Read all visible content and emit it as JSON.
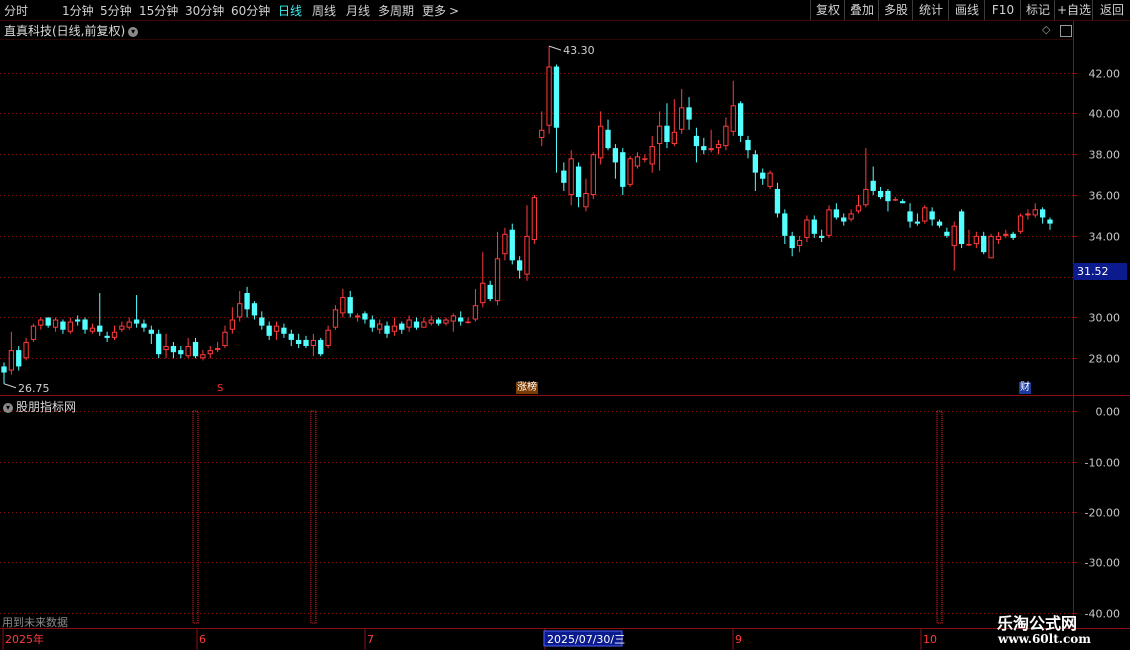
{
  "toolbar": {
    "periods": [
      "分时",
      "1分钟",
      "5分钟",
      "15分钟",
      "30分钟",
      "60分钟",
      "日线",
      "周线",
      "月线",
      "多周期",
      "更多"
    ],
    "active_period": "日线",
    "more_arrow": ">",
    "right_buttons": [
      "复权",
      "叠加",
      "多股",
      "统计",
      "画线",
      "F10",
      "+自选",
      "返回"
    ],
    "mark_button": "标记"
  },
  "header": {
    "stock_title": "直真科技(日线,前复权)",
    "collapse_icon": "chevron-down-icon"
  },
  "indicator": {
    "title": "股朋指标网",
    "warning": "用到未来数据"
  },
  "price_tag": "31.52",
  "markers": [
    {
      "text": "S",
      "color": "#ff3030"
    },
    {
      "text": "涨榜",
      "color": "#ffffff",
      "bg": "#7a3a00"
    },
    {
      "text": "财",
      "color": "#ffffff",
      "bg": "#1a3aa0"
    }
  ],
  "time_axis": {
    "labels": [
      "2025年",
      "6",
      "7",
      "2025/07/30/三",
      "9",
      "10"
    ],
    "highlight": "2025/07/30/三"
  },
  "watermark": {
    "line1": "乐淘公式网",
    "line2": "www.60lt.com"
  },
  "colors": {
    "up": "#ff3b3b",
    "down": "#54ffff",
    "grid": "#8b1010",
    "axis_text": "#c8c8c8",
    "active_period": "#3af0f0"
  },
  "chart_data": {
    "type": "candlestick",
    "price_axis_ticks": [
      42.0,
      40.0,
      38.0,
      36.0,
      34.0,
      32.0,
      30.0,
      28.0
    ],
    "price_ylim": [
      26.2,
      43.6
    ],
    "max_label": "43.30",
    "min_label": "26.75",
    "indicator_axis_ticks": [
      0.0,
      -10.0,
      -20.0,
      -30.0,
      -40.0
    ],
    "indicator_ylim": [
      -43,
      3
    ],
    "signal_bars": [
      {
        "index": 26,
        "from": 0.0,
        "to": -42.0
      },
      {
        "index": 42,
        "from": 0.0,
        "to": -42.0
      },
      {
        "index": 127,
        "from": 0.0,
        "to": -42.0
      }
    ],
    "candles": [
      [
        27.6,
        27.3,
        27.8,
        26.75
      ],
      [
        27.4,
        28.4,
        29.3,
        27.2
      ],
      [
        28.4,
        27.6,
        28.6,
        27.4
      ],
      [
        28.0,
        28.8,
        29.0,
        27.9
      ],
      [
        28.9,
        29.6,
        29.7,
        28.8
      ],
      [
        29.6,
        29.9,
        30.0,
        29.4
      ],
      [
        30.0,
        29.6,
        30.0,
        29.5
      ],
      [
        29.5,
        29.9,
        30.0,
        29.3
      ],
      [
        29.8,
        29.4,
        29.9,
        29.2
      ],
      [
        29.3,
        29.8,
        30.0,
        29.2
      ],
      [
        29.9,
        29.8,
        30.1,
        29.6
      ],
      [
        29.9,
        29.4,
        30.0,
        29.2
      ],
      [
        29.3,
        29.5,
        29.7,
        29.2
      ],
      [
        29.6,
        29.3,
        31.2,
        29.1
      ],
      [
        29.1,
        29.0,
        29.3,
        28.8
      ],
      [
        29.0,
        29.3,
        29.6,
        28.9
      ],
      [
        29.4,
        29.6,
        29.8,
        29.3
      ],
      [
        29.5,
        29.8,
        30.0,
        29.4
      ],
      [
        29.9,
        29.7,
        31.1,
        29.5
      ],
      [
        29.7,
        29.5,
        29.9,
        29.3
      ],
      [
        29.4,
        29.2,
        29.6,
        28.7
      ],
      [
        29.2,
        28.2,
        29.4,
        28.0
      ],
      [
        28.4,
        28.6,
        29.2,
        28.0
      ],
      [
        28.6,
        28.3,
        28.8,
        28.0
      ],
      [
        28.4,
        28.2,
        28.6,
        28.0
      ],
      [
        28.1,
        28.6,
        29.0,
        28.0
      ],
      [
        28.8,
        28.1,
        29.0,
        28.0
      ],
      [
        28.0,
        28.2,
        28.4,
        27.9
      ],
      [
        28.2,
        28.4,
        28.6,
        28.0
      ],
      [
        28.4,
        28.5,
        28.8,
        28.3
      ],
      [
        28.6,
        29.3,
        29.6,
        28.5
      ],
      [
        29.4,
        29.9,
        30.5,
        29.2
      ],
      [
        30.0,
        30.7,
        31.3,
        29.8
      ],
      [
        31.2,
        30.4,
        31.5,
        30.0
      ],
      [
        30.7,
        30.1,
        30.8,
        29.9
      ],
      [
        30.0,
        29.6,
        30.3,
        29.4
      ],
      [
        29.6,
        29.1,
        29.8,
        28.9
      ],
      [
        29.3,
        29.6,
        29.8,
        28.9
      ],
      [
        29.5,
        29.2,
        29.7,
        29.0
      ],
      [
        29.2,
        28.9,
        29.4,
        28.6
      ],
      [
        28.9,
        28.7,
        29.2,
        28.5
      ],
      [
        28.9,
        28.6,
        29.1,
        28.5
      ],
      [
        28.6,
        28.9,
        29.2,
        28.1
      ],
      [
        28.9,
        28.2,
        29.0,
        28.1
      ],
      [
        28.6,
        29.4,
        29.6,
        28.5
      ],
      [
        29.5,
        30.4,
        30.6,
        29.4
      ],
      [
        30.2,
        31.0,
        31.4,
        30.0
      ],
      [
        31.0,
        30.2,
        31.3,
        30.0
      ],
      [
        30.0,
        30.1,
        30.2,
        29.8
      ],
      [
        30.2,
        29.9,
        30.3,
        29.7
      ],
      [
        29.9,
        29.5,
        30.1,
        29.3
      ],
      [
        29.4,
        29.7,
        29.9,
        29.2
      ],
      [
        29.6,
        29.2,
        29.8,
        29.0
      ],
      [
        29.3,
        29.6,
        30.0,
        29.1
      ],
      [
        29.7,
        29.4,
        29.8,
        29.2
      ],
      [
        29.5,
        29.9,
        30.1,
        29.3
      ],
      [
        29.8,
        29.5,
        30.0,
        29.4
      ],
      [
        29.5,
        29.8,
        30.0,
        29.5
      ],
      [
        29.7,
        29.9,
        30.1,
        29.6
      ],
      [
        29.9,
        29.7,
        30.0,
        29.6
      ],
      [
        29.7,
        29.9,
        30.0,
        29.6
      ],
      [
        29.8,
        30.1,
        30.2,
        29.3
      ],
      [
        30.0,
        29.8,
        30.3,
        29.6
      ],
      [
        29.8,
        29.8,
        30.0,
        29.7
      ],
      [
        29.9,
        30.6,
        31.4,
        29.8
      ],
      [
        30.7,
        31.7,
        33.2,
        30.5
      ],
      [
        31.6,
        30.9,
        31.8,
        30.8
      ],
      [
        30.8,
        32.9,
        34.2,
        30.6
      ],
      [
        33.1,
        34.1,
        34.4,
        32.8
      ],
      [
        34.3,
        32.8,
        34.6,
        32.6
      ],
      [
        32.8,
        32.3,
        33.0,
        31.9
      ],
      [
        32.1,
        34.0,
        35.5,
        31.8
      ],
      [
        33.8,
        35.9,
        36.0,
        33.6
      ],
      [
        38.8,
        39.2,
        40.1,
        38.4
      ],
      [
        39.4,
        42.3,
        43.3,
        39.0
      ],
      [
        42.3,
        39.3,
        42.4,
        37.1
      ],
      [
        37.2,
        36.6,
        37.6,
        36.2
      ],
      [
        36.0,
        37.8,
        38.2,
        35.5
      ],
      [
        37.4,
        35.9,
        37.6,
        35.4
      ],
      [
        35.4,
        36.1,
        36.8,
        35.2
      ],
      [
        36.0,
        38.0,
        38.1,
        35.8
      ],
      [
        37.8,
        39.4,
        40.1,
        37.5
      ],
      [
        39.2,
        38.3,
        39.7,
        38.2
      ],
      [
        38.3,
        37.6,
        38.5,
        36.8
      ],
      [
        38.1,
        36.4,
        38.3,
        36.0
      ],
      [
        36.5,
        37.8,
        37.9,
        36.4
      ],
      [
        37.4,
        37.9,
        38.1,
        37.3
      ],
      [
        37.8,
        37.8,
        38.0,
        37.6
      ],
      [
        37.5,
        38.4,
        38.9,
        37.1
      ],
      [
        38.5,
        39.4,
        40.1,
        37.2
      ],
      [
        39.4,
        38.6,
        40.5,
        38.3
      ],
      [
        38.5,
        39.1,
        40.7,
        38.4
      ],
      [
        39.2,
        40.3,
        41.2,
        39.0
      ],
      [
        40.3,
        39.7,
        40.8,
        39.2
      ],
      [
        38.9,
        38.4,
        39.3,
        37.6
      ],
      [
        38.4,
        38.2,
        38.8,
        38.0
      ],
      [
        38.2,
        38.3,
        39.2,
        38.1
      ],
      [
        38.3,
        38.5,
        38.7,
        38.0
      ],
      [
        38.4,
        39.4,
        39.8,
        38.2
      ],
      [
        39.1,
        40.4,
        41.6,
        38.9
      ],
      [
        40.5,
        38.9,
        40.6,
        38.6
      ],
      [
        38.7,
        38.2,
        38.9,
        37.8
      ],
      [
        38.0,
        37.1,
        38.2,
        36.2
      ],
      [
        37.1,
        36.8,
        37.3,
        36.5
      ],
      [
        36.4,
        37.1,
        37.2,
        36.3
      ],
      [
        36.3,
        35.1,
        36.6,
        34.9
      ],
      [
        35.1,
        34.0,
        35.3,
        33.6
      ],
      [
        34.0,
        33.4,
        34.2,
        33.0
      ],
      [
        33.5,
        33.8,
        34.0,
        33.2
      ],
      [
        33.9,
        34.8,
        35.0,
        33.7
      ],
      [
        34.8,
        34.1,
        35.0,
        33.9
      ],
      [
        34.0,
        33.9,
        34.3,
        33.7
      ],
      [
        34.0,
        35.3,
        35.5,
        33.9
      ],
      [
        35.3,
        34.9,
        35.6,
        34.8
      ],
      [
        34.9,
        34.7,
        35.1,
        34.5
      ],
      [
        34.8,
        35.1,
        35.3,
        34.7
      ],
      [
        35.2,
        35.5,
        36.0,
        35.1
      ],
      [
        35.5,
        36.3,
        38.3,
        35.4
      ],
      [
        36.7,
        36.2,
        37.4,
        36.0
      ],
      [
        36.2,
        35.9,
        36.4,
        35.8
      ],
      [
        36.2,
        35.7,
        36.3,
        35.2
      ],
      [
        35.8,
        35.8,
        35.9,
        35.7
      ],
      [
        35.7,
        35.6,
        35.8,
        35.6
      ],
      [
        35.2,
        34.7,
        35.6,
        34.4
      ],
      [
        34.7,
        34.6,
        35.1,
        34.5
      ],
      [
        34.7,
        35.4,
        35.5,
        34.6
      ],
      [
        35.2,
        34.8,
        35.4,
        34.5
      ],
      [
        34.7,
        34.5,
        34.8,
        34.4
      ],
      [
        34.2,
        34.0,
        34.4,
        33.9
      ],
      [
        33.5,
        34.5,
        34.7,
        32.3
      ],
      [
        35.2,
        33.6,
        35.3,
        33.4
      ],
      [
        33.6,
        33.6,
        34.3,
        33.5
      ],
      [
        33.6,
        34.0,
        34.2,
        33.4
      ],
      [
        34.0,
        33.2,
        34.2,
        33.1
      ],
      [
        32.9,
        34.0,
        34.1,
        32.9
      ],
      [
        33.8,
        34.0,
        34.2,
        33.6
      ],
      [
        34.0,
        34.1,
        34.3,
        33.9
      ],
      [
        34.1,
        33.9,
        34.2,
        33.8
      ],
      [
        34.2,
        35.0,
        35.1,
        34.1
      ],
      [
        35.0,
        35.1,
        35.3,
        34.8
      ],
      [
        35.0,
        35.3,
        35.6,
        34.9
      ],
      [
        35.3,
        34.9,
        35.4,
        34.6
      ],
      [
        34.8,
        34.6,
        34.9,
        34.3
      ]
    ]
  }
}
